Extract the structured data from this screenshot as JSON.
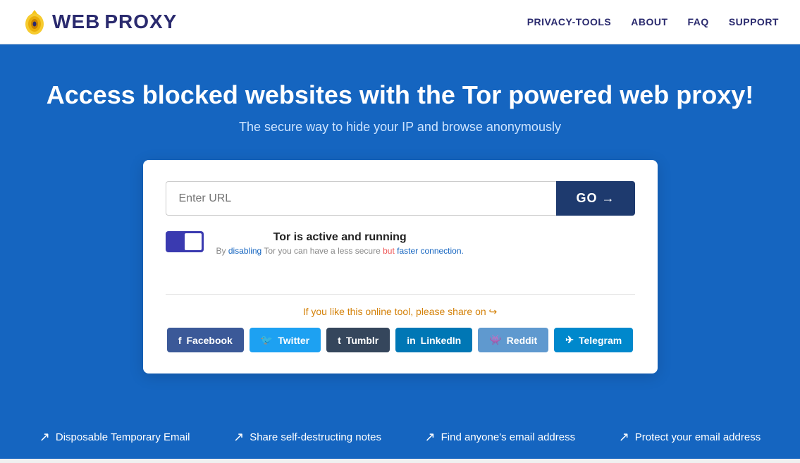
{
  "header": {
    "logo_web": "WEB",
    "logo_proxy": "PROXY",
    "nav": [
      {
        "label": "PRIVACY-TOOLS",
        "href": "#"
      },
      {
        "label": "ABOUT",
        "href": "#"
      },
      {
        "label": "FAQ",
        "href": "#"
      },
      {
        "label": "SUPPORT",
        "href": "#"
      }
    ]
  },
  "hero": {
    "headline": "Access blocked websites with the Tor powered web proxy!",
    "subheadline": "The secure way to hide your IP and browse anonymously"
  },
  "proxy_box": {
    "url_placeholder": "Enter URL",
    "go_button": "GO →",
    "tor_title": "Tor is active and running",
    "tor_description_pre": "By ",
    "tor_disable_link": "disabling",
    "tor_description_mid": " Tor you can have a less secure ",
    "tor_but": "but",
    "tor_description_post": " faster connection.",
    "share_text": "If you like this online tool, please share on",
    "social_buttons": [
      {
        "label": "Facebook",
        "class": "facebook",
        "icon": "f"
      },
      {
        "label": "Twitter",
        "class": "twitter",
        "icon": "🐦"
      },
      {
        "label": "Tumblr",
        "class": "tumblr",
        "icon": "t"
      },
      {
        "label": "LinkedIn",
        "class": "linkedin",
        "icon": "in"
      },
      {
        "label": "Reddit",
        "class": "reddit",
        "icon": "👾"
      },
      {
        "label": "Telegram",
        "class": "telegram",
        "icon": "✈"
      }
    ]
  },
  "footer": {
    "links": [
      {
        "label": "Disposable Temporary Email",
        "href": "#"
      },
      {
        "label": "Share self-destructing notes",
        "href": "#"
      },
      {
        "label": "Find anyone's email address",
        "href": "#"
      },
      {
        "label": "Protect your email address",
        "href": "#"
      }
    ]
  }
}
